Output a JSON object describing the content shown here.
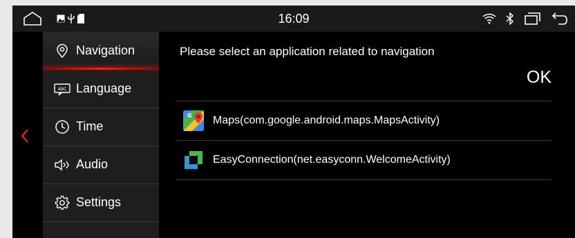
{
  "status_bar": {
    "time": "16:09",
    "icons": [
      "home-icon",
      "image-icon",
      "usb-icon",
      "sd-card-icon",
      "wifi-icon",
      "bluetooth-icon",
      "recent-apps-icon",
      "back-icon"
    ]
  },
  "sidebar": {
    "items": [
      {
        "label": "Navigation",
        "icon": "location-pin-icon",
        "active": true
      },
      {
        "label": "Language",
        "icon": "keyboard-icon",
        "active": false
      },
      {
        "label": "Time",
        "icon": "clock-icon",
        "active": false
      },
      {
        "label": "Audio",
        "icon": "speaker-icon",
        "active": false
      },
      {
        "label": "Settings",
        "icon": "gear-icon",
        "active": false
      }
    ]
  },
  "content": {
    "prompt": "Please select an application related to navigation",
    "ok_label": "OK",
    "apps": [
      {
        "label": "Maps(com.google.android.maps.MapsActivity)",
        "icon": "google-maps-icon"
      },
      {
        "label": "EasyConnection(net.easyconn.WelcomeActivity)",
        "icon": "easyconnection-icon"
      }
    ]
  },
  "colors": {
    "accent": "#e8231e",
    "background": "#000000",
    "sidebar": "#1e1e1e",
    "status_bar": "#1a1a1a"
  }
}
